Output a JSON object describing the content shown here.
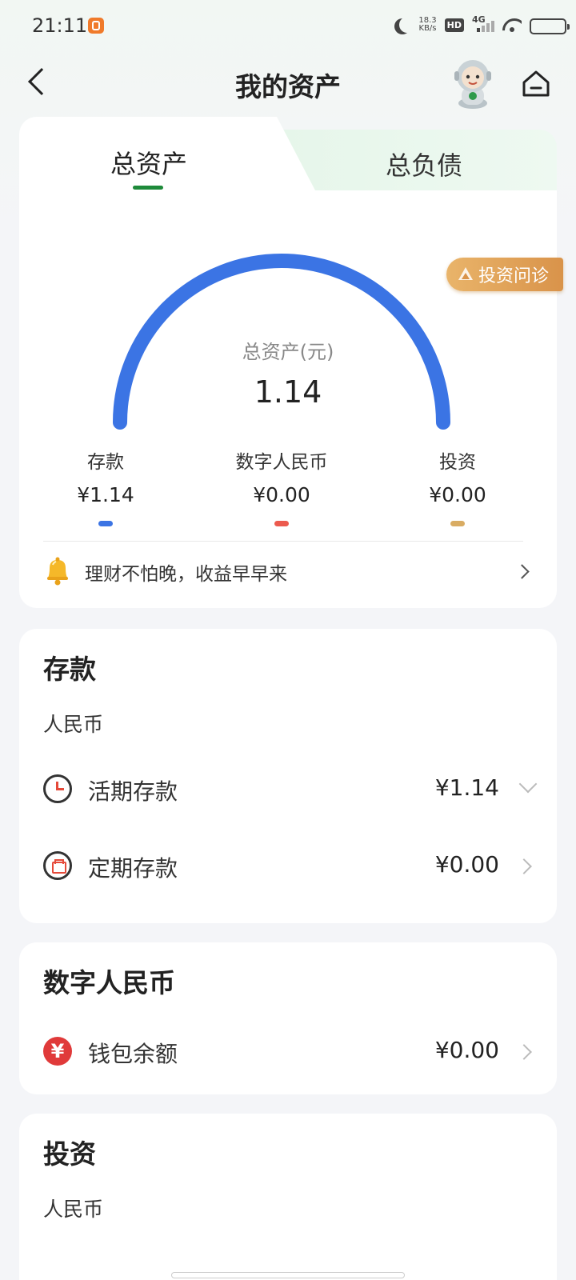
{
  "status_bar": {
    "time": "21:11",
    "net_speed_value": "18.3",
    "net_speed_unit": "KB/s",
    "hd": "HD",
    "network": "4G"
  },
  "nav": {
    "title": "我的资产"
  },
  "tabs": {
    "active": "总资产",
    "inactive": "总负债"
  },
  "invest_badge": "投资问诊",
  "summary": {
    "label": "总资产(元)",
    "value": "1.14"
  },
  "breakdown": [
    {
      "label": "存款",
      "value": "¥1.14",
      "color": "#3b74e4"
    },
    {
      "label": "数字人民币",
      "value": "¥0.00",
      "color": "#ec5a4e"
    },
    {
      "label": "投资",
      "value": "¥0.00",
      "color": "#d9ac63"
    }
  ],
  "gauge": {
    "total": 1.14,
    "color": "#3b74e4"
  },
  "tip": "理财不怕晚，收益早早来",
  "deposit": {
    "title": "存款",
    "currency": "人民币",
    "rows": [
      {
        "label": "活期存款",
        "value": "¥1.14",
        "icon": "clock-icon",
        "chevron": "down"
      },
      {
        "label": "定期存款",
        "value": "¥0.00",
        "icon": "calendar-icon",
        "chevron": "right"
      }
    ]
  },
  "digital_rmb": {
    "title": "数字人民币",
    "rows": [
      {
        "label": "钱包余额",
        "value": "¥0.00",
        "icon": "yen-icon",
        "chevron": "right"
      }
    ]
  },
  "investment": {
    "title": "投资",
    "currency": "人民币"
  }
}
